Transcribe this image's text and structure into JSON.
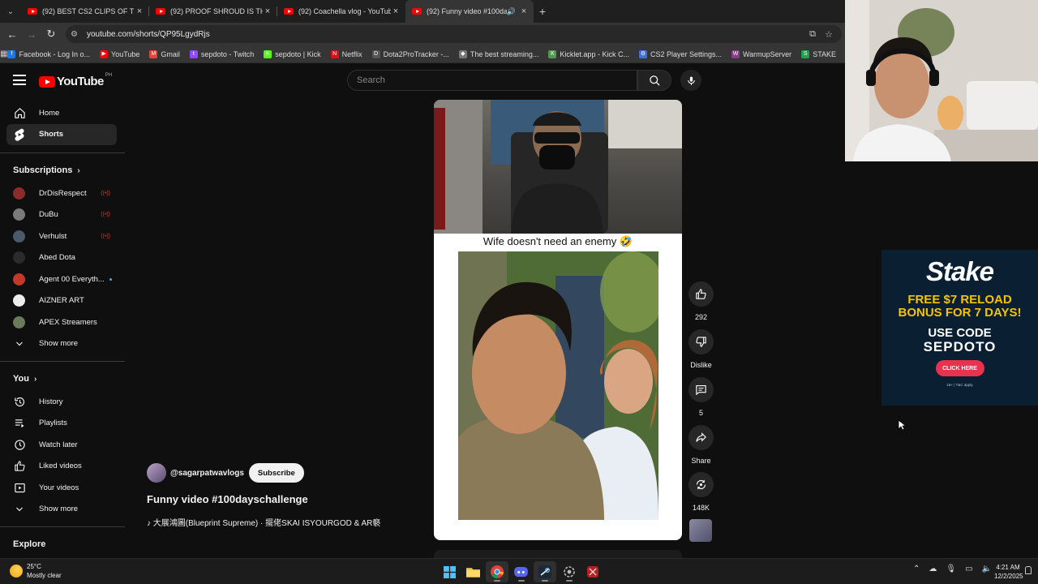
{
  "browser": {
    "tabs": [
      {
        "title": "(92) BEST CS2 CLIPS OF THE WE",
        "active": false
      },
      {
        "title": "(92) PROOF SHROUD IS THE BE",
        "active": false
      },
      {
        "title": "(92) Coachella vlog - YouTube",
        "active": false
      },
      {
        "title": "(92) Funny video #100days",
        "active": true
      }
    ],
    "url": "youtube.com/shorts/QP95LgydRjs",
    "bookmarks": [
      {
        "label": "Facebook - Log In o...",
        "color": "#1877f2",
        "glyph": "f"
      },
      {
        "label": "YouTube",
        "color": "#ff0000",
        "glyph": "▶"
      },
      {
        "label": "Gmail",
        "color": "#ea4335",
        "glyph": "M"
      },
      {
        "label": "sepdoto - Twitch",
        "color": "#9146ff",
        "glyph": "t"
      },
      {
        "label": "sepdoto | Kick",
        "color": "#53fc18",
        "glyph": "K"
      },
      {
        "label": "Netflix",
        "color": "#e50914",
        "glyph": "N"
      },
      {
        "label": "Dota2ProTracker -...",
        "color": "#555555",
        "glyph": "D"
      },
      {
        "label": "The best streaming...",
        "color": "#777777",
        "glyph": "◆"
      },
      {
        "label": "Kicklet.app - Kick C...",
        "color": "#4f9a4f",
        "glyph": "K"
      },
      {
        "label": "CS2 Player Settings...",
        "color": "#3f6fd9",
        "glyph": "⚙"
      },
      {
        "label": "WarmupServer",
        "color": "#8a3a8a",
        "glyph": "W"
      },
      {
        "label": "STAKE",
        "color": "#20a050",
        "glyph": "S"
      }
    ]
  },
  "header": {
    "logo_text": "YouTube",
    "country": "PH",
    "search_placeholder": "Search"
  },
  "sidebar": {
    "primary": [
      {
        "label": "Home",
        "icon": "home-icon"
      },
      {
        "label": "Shorts",
        "icon": "shorts-icon",
        "active": true
      }
    ],
    "subscriptions_title": "Subscriptions",
    "subscriptions": [
      {
        "label": "DrDisRespect",
        "color": "#8b2c2c",
        "live": true
      },
      {
        "label": "DuBu",
        "color": "#7a7a7a",
        "live": true
      },
      {
        "label": "Verhulst",
        "color": "#4a5a6a",
        "live": true
      },
      {
        "label": "Abed Dota",
        "color": "#2b2b2b",
        "live": false
      },
      {
        "label": "Agent 00 Everyth...",
        "color": "#c0392b",
        "live": false,
        "new": true
      },
      {
        "label": "AIZNER ART",
        "color": "#ececec",
        "live": false
      },
      {
        "label": "APEX Streamers",
        "color": "#6a7a5a",
        "live": false
      }
    ],
    "show_more": "Show more",
    "you_title": "You",
    "you_items": [
      {
        "label": "History",
        "icon": "history-icon"
      },
      {
        "label": "Playlists",
        "icon": "playlists-icon"
      },
      {
        "label": "Watch later",
        "icon": "clock-icon"
      },
      {
        "label": "Liked videos",
        "icon": "like-icon"
      },
      {
        "label": "Your videos",
        "icon": "video-icon"
      }
    ],
    "show_more_2": "Show more",
    "explore_title": "Explore"
  },
  "short": {
    "caption": "Wife doesn't need an enemy 🤣",
    "channel": "@sagarpatwavlogs",
    "subscribe": "Subscribe",
    "title": "Funny video #100dayschallenge",
    "sound": "♪ 大展鴻圖(Blueprint Supreme) · 擺佬SKAI ISYOURGOD & AR褻",
    "likes": "292",
    "dislike": "Dislike",
    "comments": "5",
    "share": "Share",
    "remix": "148K"
  },
  "ad": {
    "brand": "Stake",
    "promo_line1": "FREE $7 RELOAD",
    "promo_line2": "BONUS FOR 7 DAYS!",
    "use_code": "USE CODE",
    "code": "SEPDOTO",
    "cta": "CLICK HERE",
    "fine_print": "18+ | T&C apply"
  },
  "taskbar": {
    "temperature": "25°C",
    "weather": "Mostly clear",
    "time": "4:21 AM",
    "date": "12/2/2025"
  }
}
